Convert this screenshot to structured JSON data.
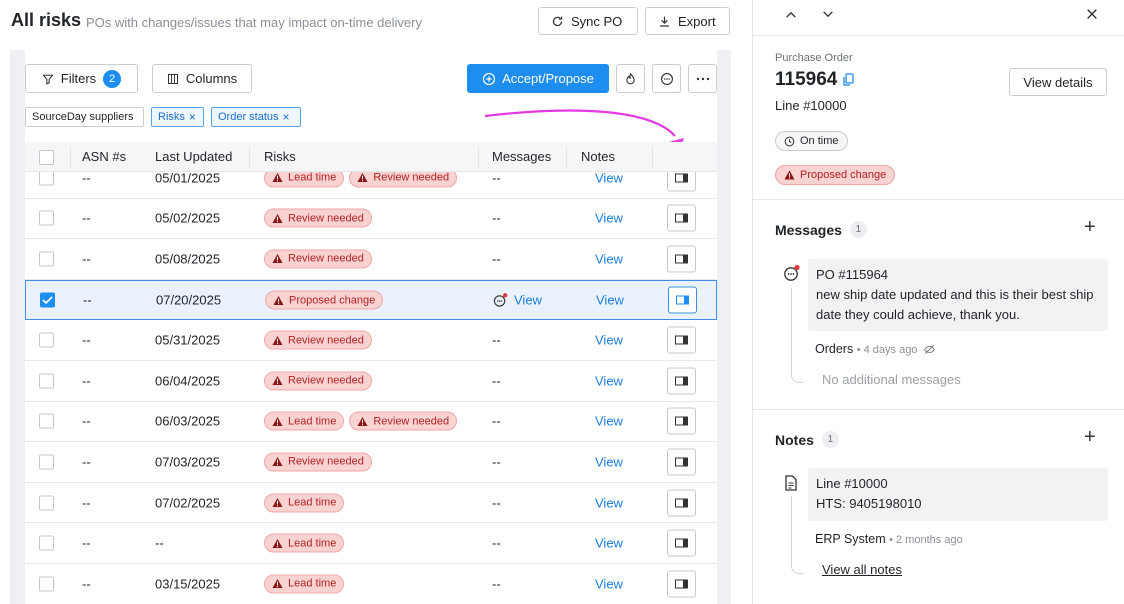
{
  "header": {
    "title": "All risks",
    "subtitle": "POs with changes/issues that may impact on-time delivery",
    "sync_label": "Sync PO",
    "export_label": "Export"
  },
  "toolbar": {
    "filters_label": "Filters",
    "filters_count": "2",
    "columns_label": "Columns",
    "accept_label": "Accept/Propose"
  },
  "chips": [
    "SourceDay suppliers",
    "Risks",
    "Order status"
  ],
  "table": {
    "columns": [
      "ASN #s",
      "Last Updated",
      "Risks",
      "Messages",
      "Notes"
    ],
    "rows": [
      {
        "asn": "--",
        "updated": "05/01/2025",
        "risks": [
          "Lead time",
          "Review needed"
        ],
        "messages": "--",
        "notes": "View",
        "selected": false
      },
      {
        "asn": "--",
        "updated": "05/02/2025",
        "risks": [
          "Review needed"
        ],
        "messages": "--",
        "notes": "View",
        "selected": false
      },
      {
        "asn": "--",
        "updated": "05/08/2025",
        "risks": [
          "Review needed"
        ],
        "messages": "--",
        "notes": "View",
        "selected": false
      },
      {
        "asn": "--",
        "updated": "07/20/2025",
        "risks": [
          "Proposed change"
        ],
        "messages": "View",
        "notes": "View",
        "selected": true
      },
      {
        "asn": "--",
        "updated": "05/31/2025",
        "risks": [
          "Review needed"
        ],
        "messages": "--",
        "notes": "View",
        "selected": false
      },
      {
        "asn": "--",
        "updated": "06/04/2025",
        "risks": [
          "Review needed"
        ],
        "messages": "--",
        "notes": "View",
        "selected": false
      },
      {
        "asn": "--",
        "updated": "06/03/2025",
        "risks": [
          "Lead time",
          "Review needed"
        ],
        "messages": "--",
        "notes": "View",
        "selected": false
      },
      {
        "asn": "--",
        "updated": "07/03/2025",
        "risks": [
          "Review needed"
        ],
        "messages": "--",
        "notes": "View",
        "selected": false
      },
      {
        "asn": "--",
        "updated": "07/02/2025",
        "risks": [
          "Lead time"
        ],
        "messages": "--",
        "notes": "View",
        "selected": false
      },
      {
        "asn": "--",
        "updated": "--",
        "risks": [
          "Lead time"
        ],
        "messages": "--",
        "notes": "View",
        "selected": false
      },
      {
        "asn": "--",
        "updated": "03/15/2025",
        "risks": [
          "Lead time"
        ],
        "messages": "--",
        "notes": "View",
        "selected": false
      }
    ]
  },
  "detail": {
    "label": "Purchase Order",
    "po_number": "115964",
    "line": "Line #10000",
    "view_details": "View details",
    "status": "On time",
    "risk": "Proposed change",
    "messages": {
      "title": "Messages",
      "count": "1",
      "po_ref": "PO #115964",
      "body": "new ship date updated and this is their best ship date they could achieve, thank you.",
      "author": "Orders",
      "time": "4 days ago",
      "none": "No additional messages"
    },
    "notes": {
      "title": "Notes",
      "count": "1",
      "line": "Line #10000",
      "hts": "HTS: 9405198010",
      "author": "ERP System",
      "time": "2 months ago",
      "view_all": "View all notes"
    }
  },
  "colors": {
    "primary": "#1d8df0",
    "risk_bg": "#f9d2d2",
    "risk_text": "#b42323",
    "annotation_arrow": "#e33be3"
  }
}
